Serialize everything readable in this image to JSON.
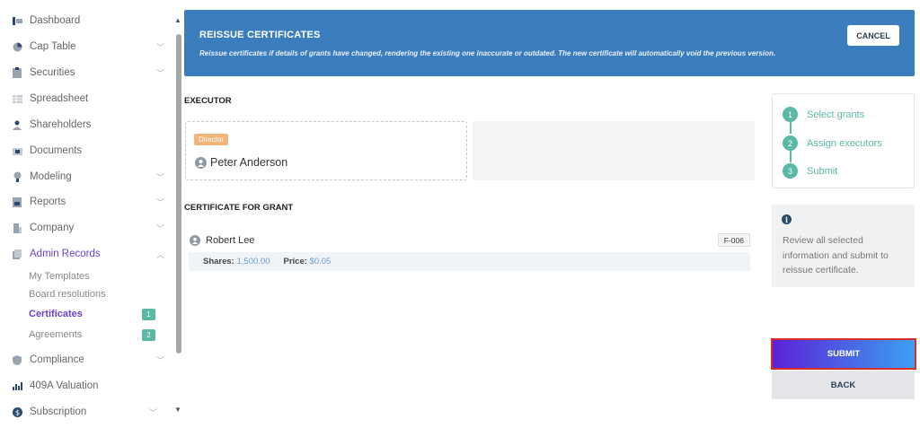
{
  "sidebar": {
    "items": [
      {
        "label": "Dashboard",
        "icon": "dashboard-icon",
        "chevron": ""
      },
      {
        "label": "Cap Table",
        "icon": "pie-chart-icon",
        "chevron": "﹀"
      },
      {
        "label": "Securities",
        "icon": "clipboard-icon",
        "chevron": "﹀"
      },
      {
        "label": "Spreadsheet",
        "icon": "spreadsheet-icon",
        "chevron": ""
      },
      {
        "label": "Shareholders",
        "icon": "person-icon",
        "chevron": ""
      },
      {
        "label": "Documents",
        "icon": "folder-icon",
        "chevron": ""
      },
      {
        "label": "Modeling",
        "icon": "lightbulb-icon",
        "chevron": "﹀"
      },
      {
        "label": "Reports",
        "icon": "report-icon",
        "chevron": "﹀"
      },
      {
        "label": "Company",
        "icon": "building-icon",
        "chevron": "﹀"
      },
      {
        "label": "Admin Records",
        "icon": "records-icon",
        "chevron": "︿"
      },
      {
        "label": "Compliance",
        "icon": "shield-icon",
        "chevron": "﹀"
      },
      {
        "label": "409A Valuation",
        "icon": "chart-icon",
        "chevron": ""
      },
      {
        "label": "Subscription",
        "icon": "dollar-icon",
        "chevron": "﹀"
      }
    ],
    "admin_sub": [
      {
        "label": "My Templates",
        "badge": ""
      },
      {
        "label": "Board resolutions",
        "badge": ""
      },
      {
        "label": "Certificates",
        "badge": "1"
      },
      {
        "label": "Agreements",
        "badge": "2"
      }
    ]
  },
  "header": {
    "title": "REISSUE CERTIFICATES",
    "subtitle": "Reissue certificates if details of grants have changed, rendering the existing one inaccurate or outdated. The new certificate will automatically void the previous version.",
    "cancel_label": "CANCEL"
  },
  "executor": {
    "section_title": "EXECUTOR",
    "role": "Director",
    "name": "Peter Anderson"
  },
  "grant": {
    "section_title": "CERTIFICATE FOR GRANT",
    "holder": "Robert Lee",
    "id": "F-006",
    "shares_label": "Shares:",
    "shares_value": "1,500.00",
    "price_label": "Price:",
    "price_value": "$0.05"
  },
  "stepper": {
    "steps": [
      {
        "num": "1",
        "label": "Select grants"
      },
      {
        "num": "2",
        "label": "Assign executors"
      },
      {
        "num": "3",
        "label": "Submit"
      }
    ]
  },
  "info": {
    "icon": "info-icon",
    "text": "Review all selected information and submit to reissue certificate."
  },
  "actions": {
    "submit_label": "SUBMIT",
    "back_label": "BACK"
  },
  "colors": {
    "banner": "#3c7ebd",
    "accent_purple": "#6b3fd6",
    "teal": "#59b8a6",
    "submit_gradient_start": "#5a22d6",
    "submit_gradient_end": "#3ca0f3"
  }
}
